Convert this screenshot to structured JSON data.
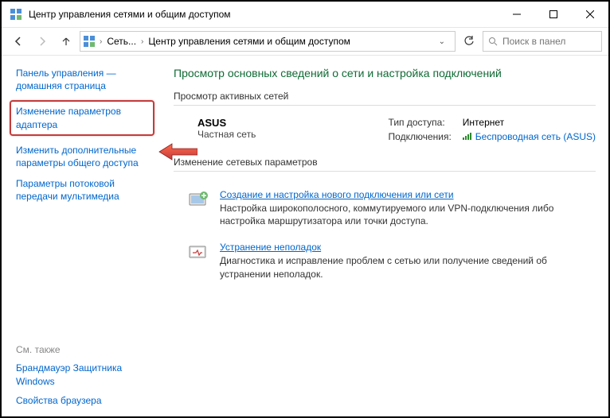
{
  "window": {
    "title": "Центр управления сетями и общим доступом"
  },
  "breadcrumb": {
    "part1": "Сеть...",
    "part2": "Центр управления сетями и общим доступом"
  },
  "search": {
    "placeholder": "Поиск в панел"
  },
  "sidebar": {
    "home": "Панель управления — домашняя страница",
    "adapter": "Изменение параметров адаптера",
    "sharing": "Изменить дополнительные параметры общего доступа",
    "media": "Параметры потоковой передачи мультимедиа",
    "seealso_label": "См. также",
    "firewall": "Брандмауэр Защитника Windows",
    "browser": "Свойства браузера"
  },
  "main": {
    "heading": "Просмотр основных сведений о сети и настройка подключений",
    "active_label": "Просмотр активных сетей",
    "network": {
      "name": "ASUS",
      "type": "Частная сеть",
      "access_label": "Тип доступа:",
      "access_value": "Интернет",
      "connections_label": "Подключения:",
      "connection_name": "Беспроводная сеть (ASUS)"
    },
    "change_label": "Изменение сетевых параметров",
    "item1": {
      "title": "Создание и настройка нового подключения или сети",
      "desc": "Настройка широкополосного, коммутируемого или VPN-подключения либо настройка маршрутизатора или точки доступа."
    },
    "item2": {
      "title": "Устранение неполадок",
      "desc": "Диагностика и исправление проблем с сетью или получение сведений об устранении неполадок."
    }
  }
}
